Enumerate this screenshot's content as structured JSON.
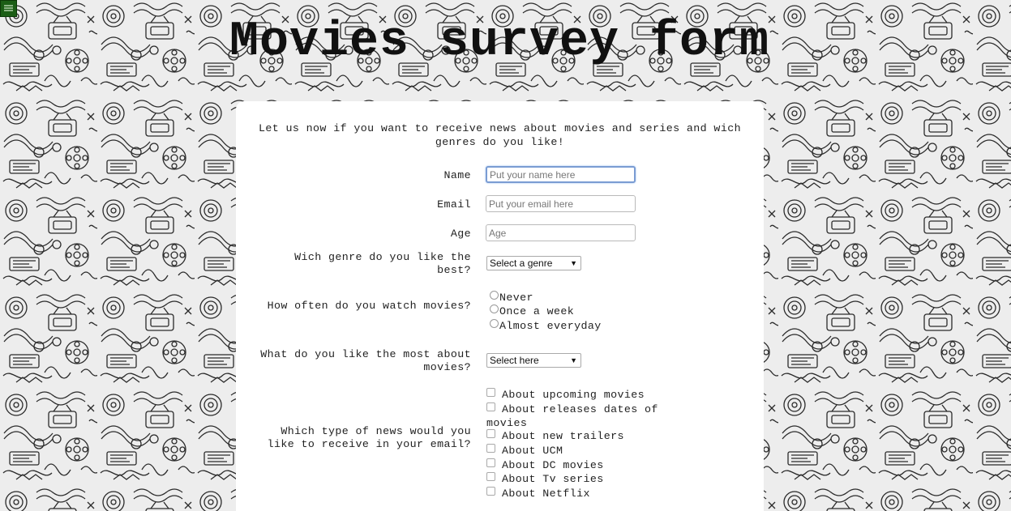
{
  "page": {
    "title": "Movies survey form",
    "intro": "Let us now if you want to receive news about movies and series and wich genres do you like!"
  },
  "fields": {
    "name_label": "Name",
    "name_placeholder": "Put your name here",
    "email_label": "Email",
    "email_placeholder": "Put your email here",
    "age_label": "Age",
    "age_placeholder": "Age"
  },
  "genre": {
    "label": "Wich genre do you like the best?",
    "selected": "Select a genre"
  },
  "frequency": {
    "label": "How often do you watch movies?",
    "options": [
      "Never",
      "Once a week",
      "Almost everyday"
    ]
  },
  "likes": {
    "label": "What do you like the most about movies?",
    "selected": "Select here"
  },
  "news": {
    "label": "Which type of news would you like to receive in your email?",
    "options": [
      "About upcoming movies",
      "About releases dates of movies",
      "About new trailers",
      "About UCM",
      "About DC movies",
      "About Tv series",
      "About Netflix"
    ]
  },
  "colors": {
    "card": "#ffffff",
    "badge": "#1c5e16",
    "focus_border": "#7a9cd3"
  },
  "icons": {
    "background": "cinema-doodle-pattern",
    "badge": "freecodecamp-badge-icon"
  }
}
